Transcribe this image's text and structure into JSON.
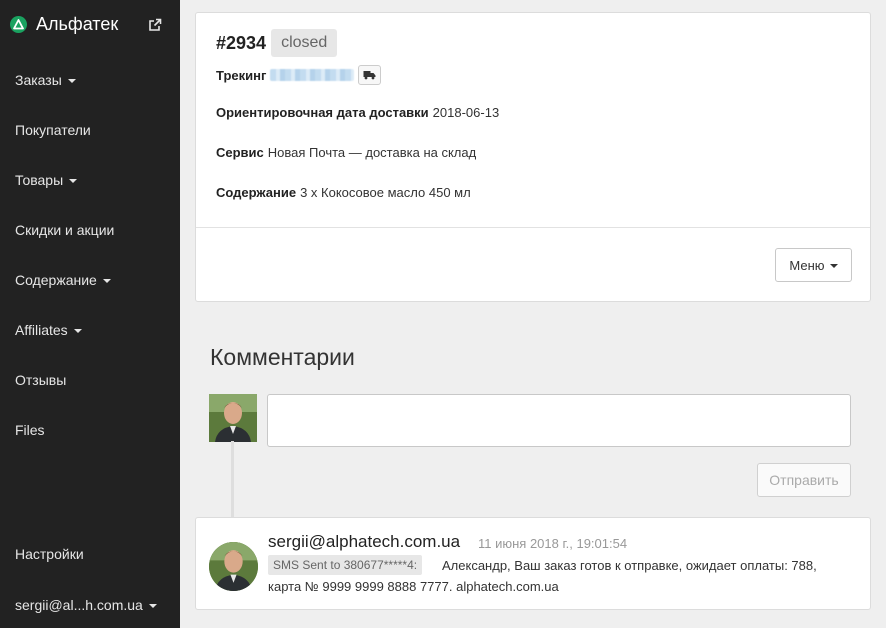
{
  "sidebar": {
    "brand": "Альфатек",
    "items": [
      {
        "label": "Заказы",
        "dropdown": true
      },
      {
        "label": "Покупатели",
        "dropdown": false
      },
      {
        "label": "Товары",
        "dropdown": true
      },
      {
        "label": "Скидки и акции",
        "dropdown": false
      },
      {
        "label": "Содержание",
        "dropdown": true
      },
      {
        "label": "Affiliates",
        "dropdown": true
      },
      {
        "label": "Отзывы",
        "dropdown": false
      },
      {
        "label": "Files",
        "dropdown": false
      }
    ],
    "settings": "Настройки",
    "user": "sergii@al...h.com.ua"
  },
  "order": {
    "number": "#2934",
    "status": "closed",
    "tracking_label": "Трекинг",
    "delivery_label": "Ориентировочная дата доставки",
    "delivery_date": "2018-06-13",
    "service_label": "Сервис",
    "service_value": "Новая Почта — доставка на склад",
    "content_label": "Содержание",
    "content_value": "3 x Кокосовое масло 450 мл",
    "menu_label": "Меню"
  },
  "comments": {
    "title": "Комментарии",
    "input_value": "",
    "send_label": "Отправить",
    "items": [
      {
        "author": "sergii@alphatech.com.ua",
        "time": "11 июня 2018 г., 19:01:54",
        "tag": "SMS Sent to 380677*****4:",
        "text_line1": "Александр, Ваш заказ готов к отправке, ожидает оплаты: 788,",
        "text_line2": "карта № 9999 9999 8888 7777. alphatech.com.ua"
      }
    ]
  },
  "colors": {
    "sidebar_bg": "#222222",
    "brand_logo": "#1aa260",
    "page_bg": "#efefef",
    "badge_bg": "#e7e7e7"
  },
  "icons": [
    "brand-logo-icon",
    "external-link-icon",
    "truck-icon",
    "caret-down-icon"
  ]
}
